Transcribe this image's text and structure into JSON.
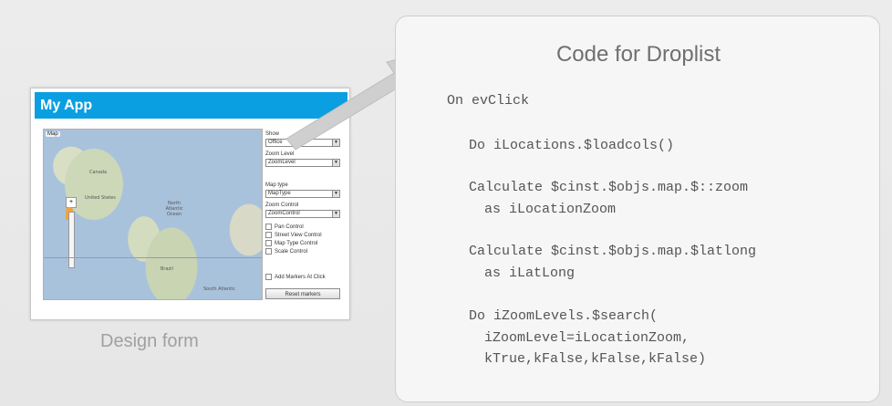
{
  "design_form": {
    "app_title": "My App",
    "map_tag": "Map",
    "map_labels": [
      "United States",
      "North Atlantic Ocean",
      "Brazil",
      "South Atlantic",
      "Canada"
    ],
    "controls": {
      "show_label": "Show",
      "show_value": "Office",
      "zoom_level_label": "Zoom Level",
      "zoom_level_value": "ZoomLevel",
      "map_type_label": "Map type",
      "map_type_value": "MapType",
      "zoom_control_label": "Zoom Control",
      "zoom_control_value": "ZoomControl",
      "checkboxes": [
        "Pan Control",
        "Street View Control",
        "Map Type Control",
        "Scale Control"
      ],
      "add_markers_label": "Add Markers At Click",
      "reset_button": "Reset markers"
    },
    "caption": "Design form"
  },
  "code_panel": {
    "title": "Code for Droplist",
    "lines": [
      "On evClick",
      "Do iLocations.$loadcols()",
      "Calculate $cinst.$objs.map.$::zoom",
      "as iLocationZoom",
      "Calculate $cinst.$objs.map.$latlong",
      "as iLatLong",
      "Do iZoomLevels.$search(",
      "iZoomLevel=iLocationZoom,",
      "kTrue,kFalse,kFalse,kFalse)"
    ]
  },
  "colors": {
    "app_header": "#0a9fe0",
    "background": "#e9e9e9",
    "panel": "#f6f6f6"
  }
}
